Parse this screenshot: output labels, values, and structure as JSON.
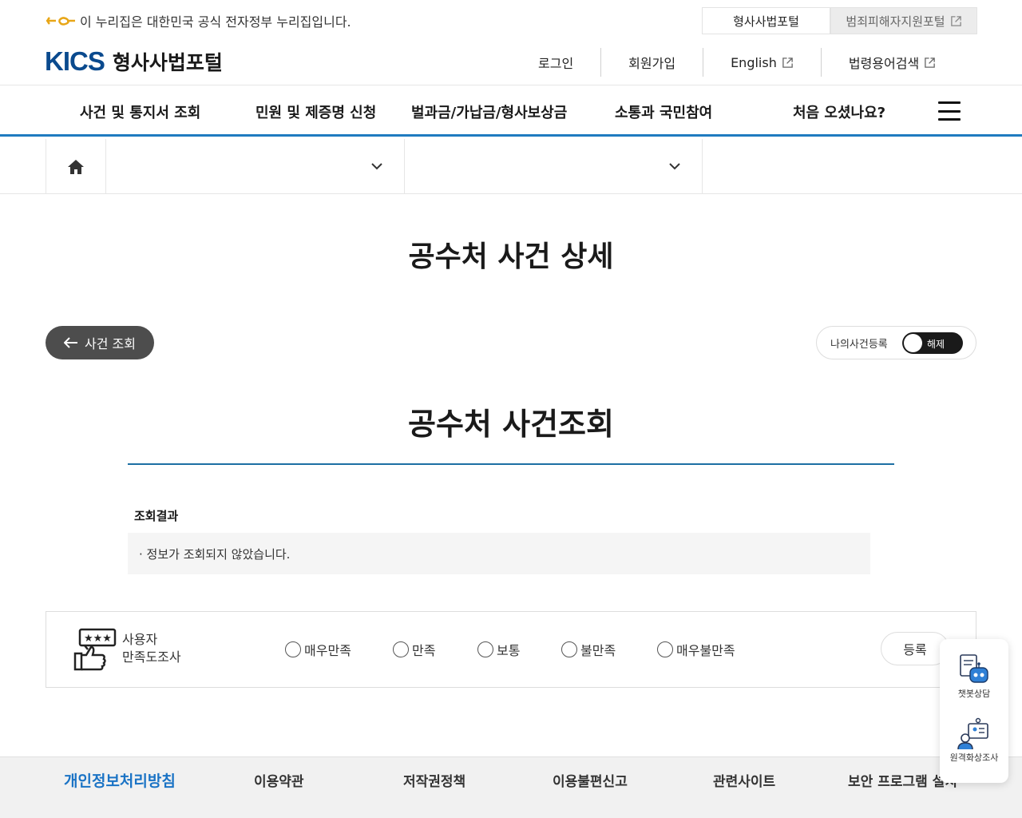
{
  "gov_bar": {
    "text": "이 누리집은 대한민국 공식 전자정부 누리집입니다.",
    "portal_tabs": [
      {
        "label": "형사사법포털",
        "active": true
      },
      {
        "label": "범죄피해자지원포털",
        "active": false,
        "external": true
      }
    ]
  },
  "header": {
    "brand_logo": "KICS",
    "brand_name": "형사사법포털",
    "util_nav": [
      {
        "label": "로그인",
        "external": false
      },
      {
        "label": "회원가입",
        "external": false
      },
      {
        "label": "English",
        "external": true
      },
      {
        "label": "법령용어검색",
        "external": true
      }
    ]
  },
  "gnb": {
    "items": [
      "사건 및 통지서 조회",
      "민원 및 제증명 신청",
      "벌과금/가납금/형사보상금",
      "소통과 국민참여",
      "처음 오셨나요?"
    ],
    "menu_icon": "hamburger-icon"
  },
  "breadcrumb": {
    "home_icon": "home-icon",
    "dropdown1": "",
    "dropdown2": ""
  },
  "page": {
    "title": "공수처 사건 상세",
    "back_button": "사건 조회",
    "my_case_label": "나의사건등록",
    "toggle_state": "해제",
    "sub_title": "공수처 사건조회",
    "result_label": "조회결과",
    "result_text": "· 정보가 조회되지 않았습니다."
  },
  "survey": {
    "title_line1": "사용자",
    "title_line2": "만족도조사",
    "options": [
      "매우만족",
      "만족",
      "보통",
      "불만족",
      "매우불만족"
    ],
    "submit_label": "등록"
  },
  "floating": {
    "chatbot_label": "챗봇상담",
    "remote_label": "원격화상조사"
  },
  "footer": {
    "items": [
      "개인정보처리방침",
      "이용약관",
      "저작권정책",
      "이용불편신고",
      "관련사이트",
      "보안 프로그램 설치"
    ]
  },
  "colors": {
    "accent_blue": "#1f7bc0",
    "footer_primary": "#1a73c5",
    "back_button_bg": "#4d4d4d"
  }
}
